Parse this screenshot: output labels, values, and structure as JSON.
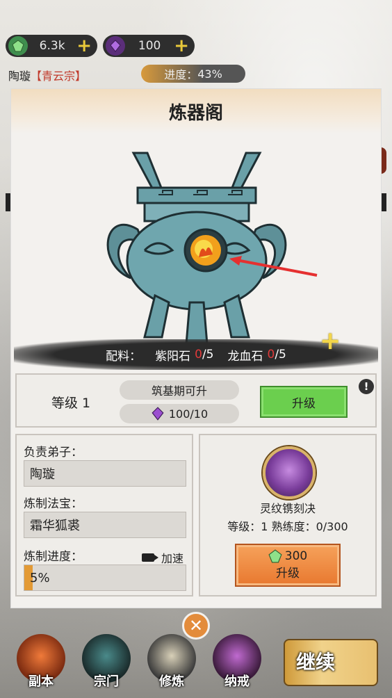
{
  "resources": {
    "jade": {
      "value": "6.3k",
      "icon": "jade-icon"
    },
    "gem": {
      "value": "100",
      "icon": "purple-gem-icon"
    }
  },
  "player": {
    "name": "陶璇",
    "sect": "【青云宗】",
    "progress_label": "进度：",
    "progress_value": "43%",
    "progress": 0.43
  },
  "panel": {
    "title": "炼器阁",
    "materials": {
      "label": "配料：",
      "items": [
        {
          "name": "紫阳石",
          "have": "0",
          "need": "/5"
        },
        {
          "name": "龙血石",
          "have": "0",
          "need": "/5"
        }
      ]
    },
    "level": {
      "label": "等级 1",
      "upgrade_req": "筑基期可升",
      "cost": "100/10",
      "upgrade_button": "升级",
      "info_icon": "!"
    },
    "craft": {
      "disciple_label": "负责弟子：",
      "disciple_value": "陶璇",
      "item_label": "炼制法宝：",
      "item_value": "霜华狐裘",
      "progress_label": "炼制进度：",
      "speed_label": "加速",
      "progress_text": "5%",
      "progress": 0.05
    },
    "skill": {
      "name": "灵纹镌刻决",
      "stats": "等级：1   熟练度：0/300",
      "cost": "300",
      "upgrade_button": "升级"
    }
  },
  "close_icon": "✕",
  "nav": [
    {
      "label": "副本"
    },
    {
      "label": "宗门"
    },
    {
      "label": "修炼"
    },
    {
      "label": "纳戒"
    }
  ],
  "continue_label": "继续",
  "colors": {
    "accent": "#e8782f",
    "green": "#6bcf4e",
    "red": "#e03a3a"
  }
}
